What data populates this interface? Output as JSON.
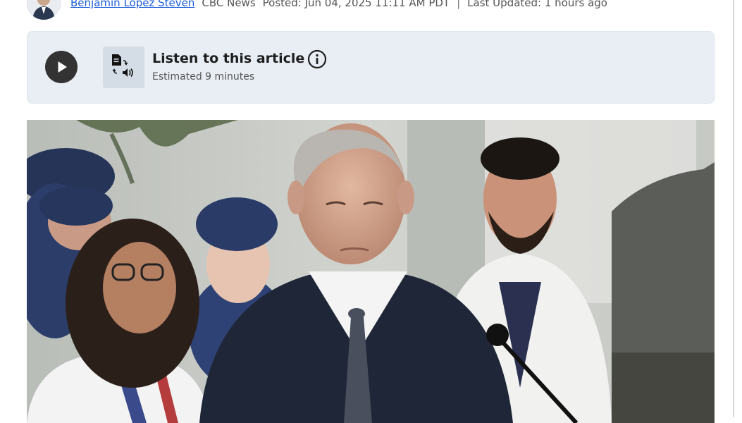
{
  "byline": {
    "author": "Benjamin Lopez Steven",
    "source": "CBC News",
    "posted": "Posted: Jun 04, 2025 11:11 AM PDT",
    "separator": "|",
    "updated": "Last Updated: 1 hours ago"
  },
  "listen": {
    "title": "Listen to this article",
    "estimate": "Estimated 9 minutes"
  },
  "icons": {
    "play": "play-icon",
    "tts": "text-to-speech-icon",
    "info": "info-icon"
  },
  "colors": {
    "link": "#1a5bd6",
    "listen_background": "#e8eef4",
    "play_button": "#333333"
  }
}
